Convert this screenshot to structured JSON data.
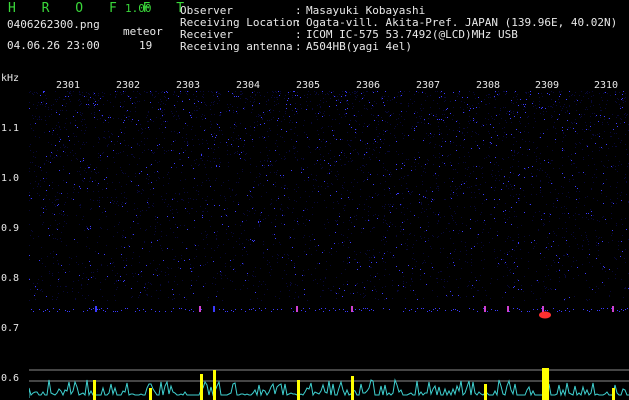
{
  "header": {
    "brand": "H R O F F T",
    "version": "1.00",
    "filename": "0406262300.png",
    "datetime": "04.06.26 23:00",
    "meteor_label": "meteor",
    "meteor_count": "19"
  },
  "info": [
    {
      "label": "Observer",
      "value": "Masayuki Kobayashi"
    },
    {
      "label": "Receiving Location",
      "value": "Ogata-vill. Akita-Pref. JAPAN (139.96E, 40.02N)"
    },
    {
      "label": "Receiver",
      "value": "ICOM IC-575 53.7492(@LCD)MHz USB"
    },
    {
      "label": "Receiving antenna",
      "value": "A504HB(yagi 4el)"
    }
  ],
  "colon": ":",
  "axis": {
    "unit": "kHz",
    "x_ticks": [
      "2301",
      "2302",
      "2303",
      "2304",
      "2305",
      "2306",
      "2307",
      "2308",
      "2309",
      "2310"
    ],
    "y_ticks": [
      "1.1",
      "1.0",
      "0.9",
      "0.8",
      "0.7",
      "0.6"
    ]
  },
  "colors": {
    "noise_dark": "#08083a",
    "noise_bright": "#3a3aff",
    "echo_hot": "#ff3030",
    "signal_trace": "#3fd0d0",
    "meteor_bar": "#ffff00",
    "brand_green": "#3ad83a"
  }
}
